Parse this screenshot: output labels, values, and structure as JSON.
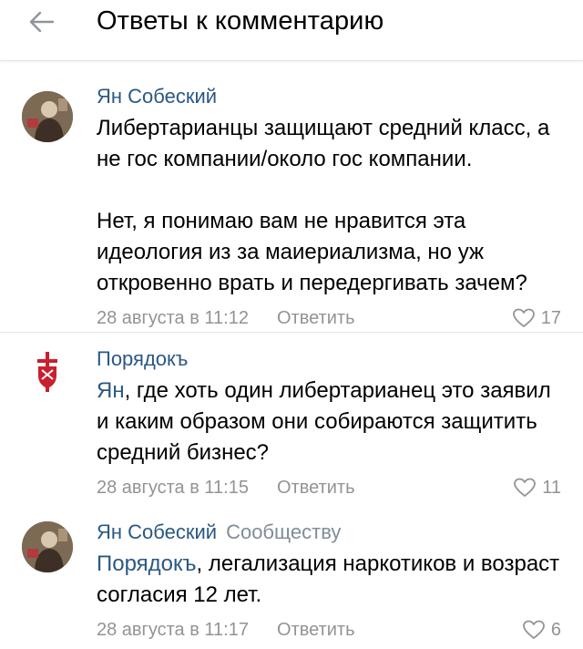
{
  "header": {
    "title": "Ответы к комментарию",
    "back_icon": "arrow-left-icon"
  },
  "comments": [
    {
      "author": "Ян Собеский",
      "author_suffix": "",
      "avatar": "user-photo",
      "mention": "",
      "text_lines": [
        "Либертарианцы защищают средний класс, а не гос компании/около гос компании.",
        "",
        "Нет, я понимаю вам не нравится эта идеология из за маиериализма, но уж откровенно врать и передергивать зачем?"
      ],
      "date": "28 августа в 11:12",
      "reply_label": "Ответить",
      "likes": "17"
    },
    {
      "author": "Порядокъ",
      "author_suffix": "",
      "avatar": "community-logo",
      "mention": "Ян",
      "text_after_mention": ", где хоть один либертарианец это заявил и каким образом они собираются защитить средний бизнес?",
      "date": "28 августа в 11:15",
      "reply_label": "Ответить",
      "likes": "11"
    },
    {
      "author": "Ян Собеский",
      "author_suffix": "Сообществу",
      "avatar": "user-photo",
      "mention": "Порядокъ",
      "text_after_mention": ", легализация наркотиков и возраст согласия 12 лет.",
      "date": "28 августа в 11:17",
      "reply_label": "Ответить",
      "likes": "6"
    }
  ],
  "colors": {
    "link": "#2a5885",
    "meta": "#939393",
    "divider": "#e7e8ec",
    "logo_red": "#c8202f"
  }
}
